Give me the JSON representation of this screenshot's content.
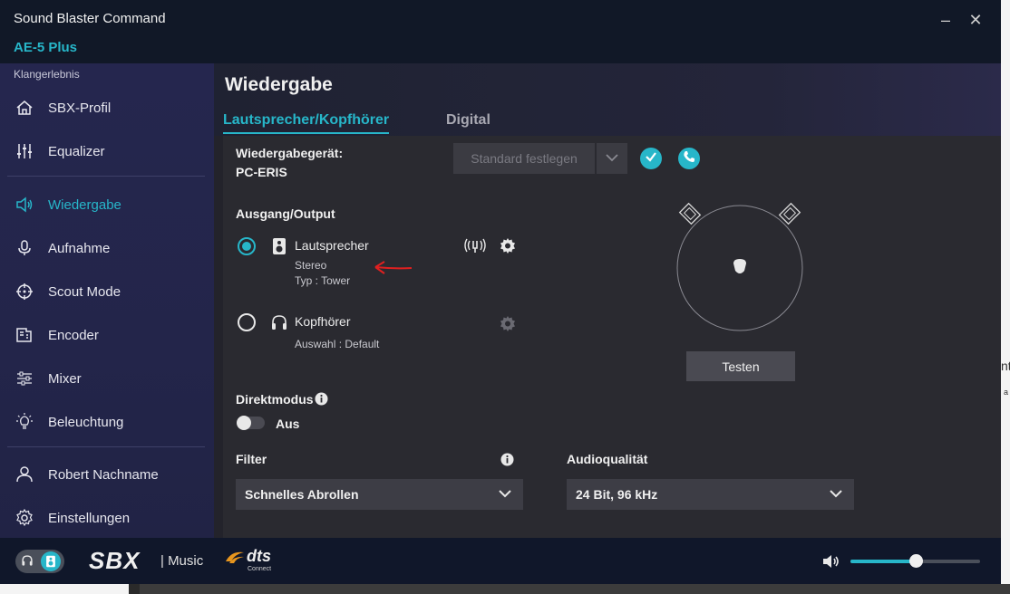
{
  "window": {
    "app_title": "Sound Blaster Command",
    "device": "AE-5 Plus",
    "minimize": "–",
    "close": "✕"
  },
  "sidebar": {
    "header": "Klangerlebnis",
    "items": [
      {
        "label": "SBX-Profil",
        "icon": "home-icon"
      },
      {
        "label": "Equalizer",
        "icon": "equalizer-icon"
      },
      {
        "label": "Wiedergabe",
        "icon": "speaker-icon",
        "active": true
      },
      {
        "label": "Aufnahme",
        "icon": "microphone-icon"
      },
      {
        "label": "Scout Mode",
        "icon": "crosshair-icon"
      },
      {
        "label": "Encoder",
        "icon": "encoder-icon"
      },
      {
        "label": "Mixer",
        "icon": "mixer-icon"
      },
      {
        "label": "Beleuchtung",
        "icon": "lightbulb-icon"
      },
      {
        "label": "Robert Nachname",
        "icon": "user-icon"
      },
      {
        "label": "Einstellungen",
        "icon": "gear-icon"
      }
    ]
  },
  "main": {
    "title": "Wiedergabe",
    "tabs": [
      {
        "label": "Lautsprecher/Kopfhörer",
        "active": true
      },
      {
        "label": "Digital",
        "active": false
      }
    ],
    "device_label": "Wiedergabegerät:",
    "device_value": "PC-ERIS",
    "standard_button": "Standard festlegen",
    "output_heading": "Ausgang/Output",
    "outputs": [
      {
        "name": "Lautsprecher",
        "line1": "Stereo",
        "line2": "Typ :  Tower",
        "selected": true
      },
      {
        "name": "Kopfhörer",
        "line1": "Auswahl :  Default",
        "selected": false
      }
    ],
    "direct_mode": {
      "label": "Direktmodus",
      "state": "Aus"
    },
    "filter": {
      "label": "Filter",
      "value": "Schnelles Abrollen"
    },
    "audio_quality": {
      "label": "Audioqualität",
      "value": "24 Bit, 96 kHz"
    },
    "test_button": "Testen"
  },
  "bottom": {
    "sbx": "SBX",
    "music": "| Music",
    "dts": "dts",
    "dts_sub": "Connect",
    "volume": 0.5
  },
  "colors": {
    "accent": "#27b6c9",
    "sidebar_bg": "#25264e",
    "annotation_arrow": "#e02020"
  },
  "background": {
    "edge_text_1": "nt",
    "edge_text_2": "a"
  }
}
